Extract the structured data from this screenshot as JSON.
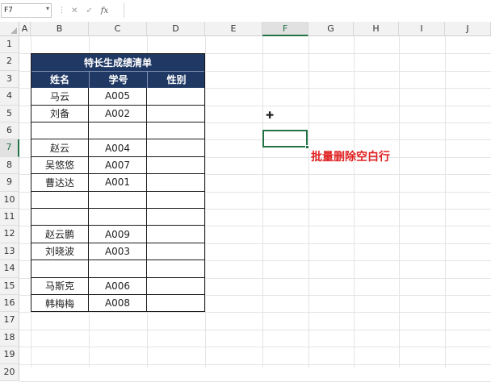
{
  "formula_bar": {
    "cell_ref": "F7",
    "cancel_icon": "✕",
    "enter_icon": "✓",
    "fx_label": "fx",
    "formula": ""
  },
  "columns": [
    "A",
    "B",
    "C",
    "D",
    "E",
    "F",
    "G",
    "H",
    "I",
    "J"
  ],
  "active_column": "F",
  "rows": [
    "1",
    "2",
    "3",
    "4",
    "5",
    "6",
    "7",
    "8",
    "9",
    "10",
    "11",
    "12",
    "13",
    "14",
    "15",
    "16",
    "17",
    "18",
    "19",
    "20"
  ],
  "active_row": "7",
  "table": {
    "title": "特长生成绩清单",
    "headers": [
      "姓名",
      "学号",
      "性别"
    ],
    "rows": [
      [
        "马云",
        "A005",
        ""
      ],
      [
        "刘备",
        "A002",
        ""
      ],
      [
        "",
        "",
        ""
      ],
      [
        "赵云",
        "A004",
        ""
      ],
      [
        "吴悠悠",
        "A007",
        ""
      ],
      [
        "曹达达",
        "A001",
        ""
      ],
      [
        "",
        "",
        ""
      ],
      [
        "",
        "",
        ""
      ],
      [
        "赵云鹏",
        "A009",
        ""
      ],
      [
        "刘晓波",
        "A003",
        ""
      ],
      [
        "",
        "",
        ""
      ],
      [
        "马斯克",
        "A006",
        ""
      ],
      [
        "韩梅梅",
        "A008",
        ""
      ]
    ]
  },
  "annotation": "批量删除空白行",
  "colors": {
    "header_fill": "#1f3864",
    "selection": "#217346",
    "annotation": "#e02020"
  }
}
